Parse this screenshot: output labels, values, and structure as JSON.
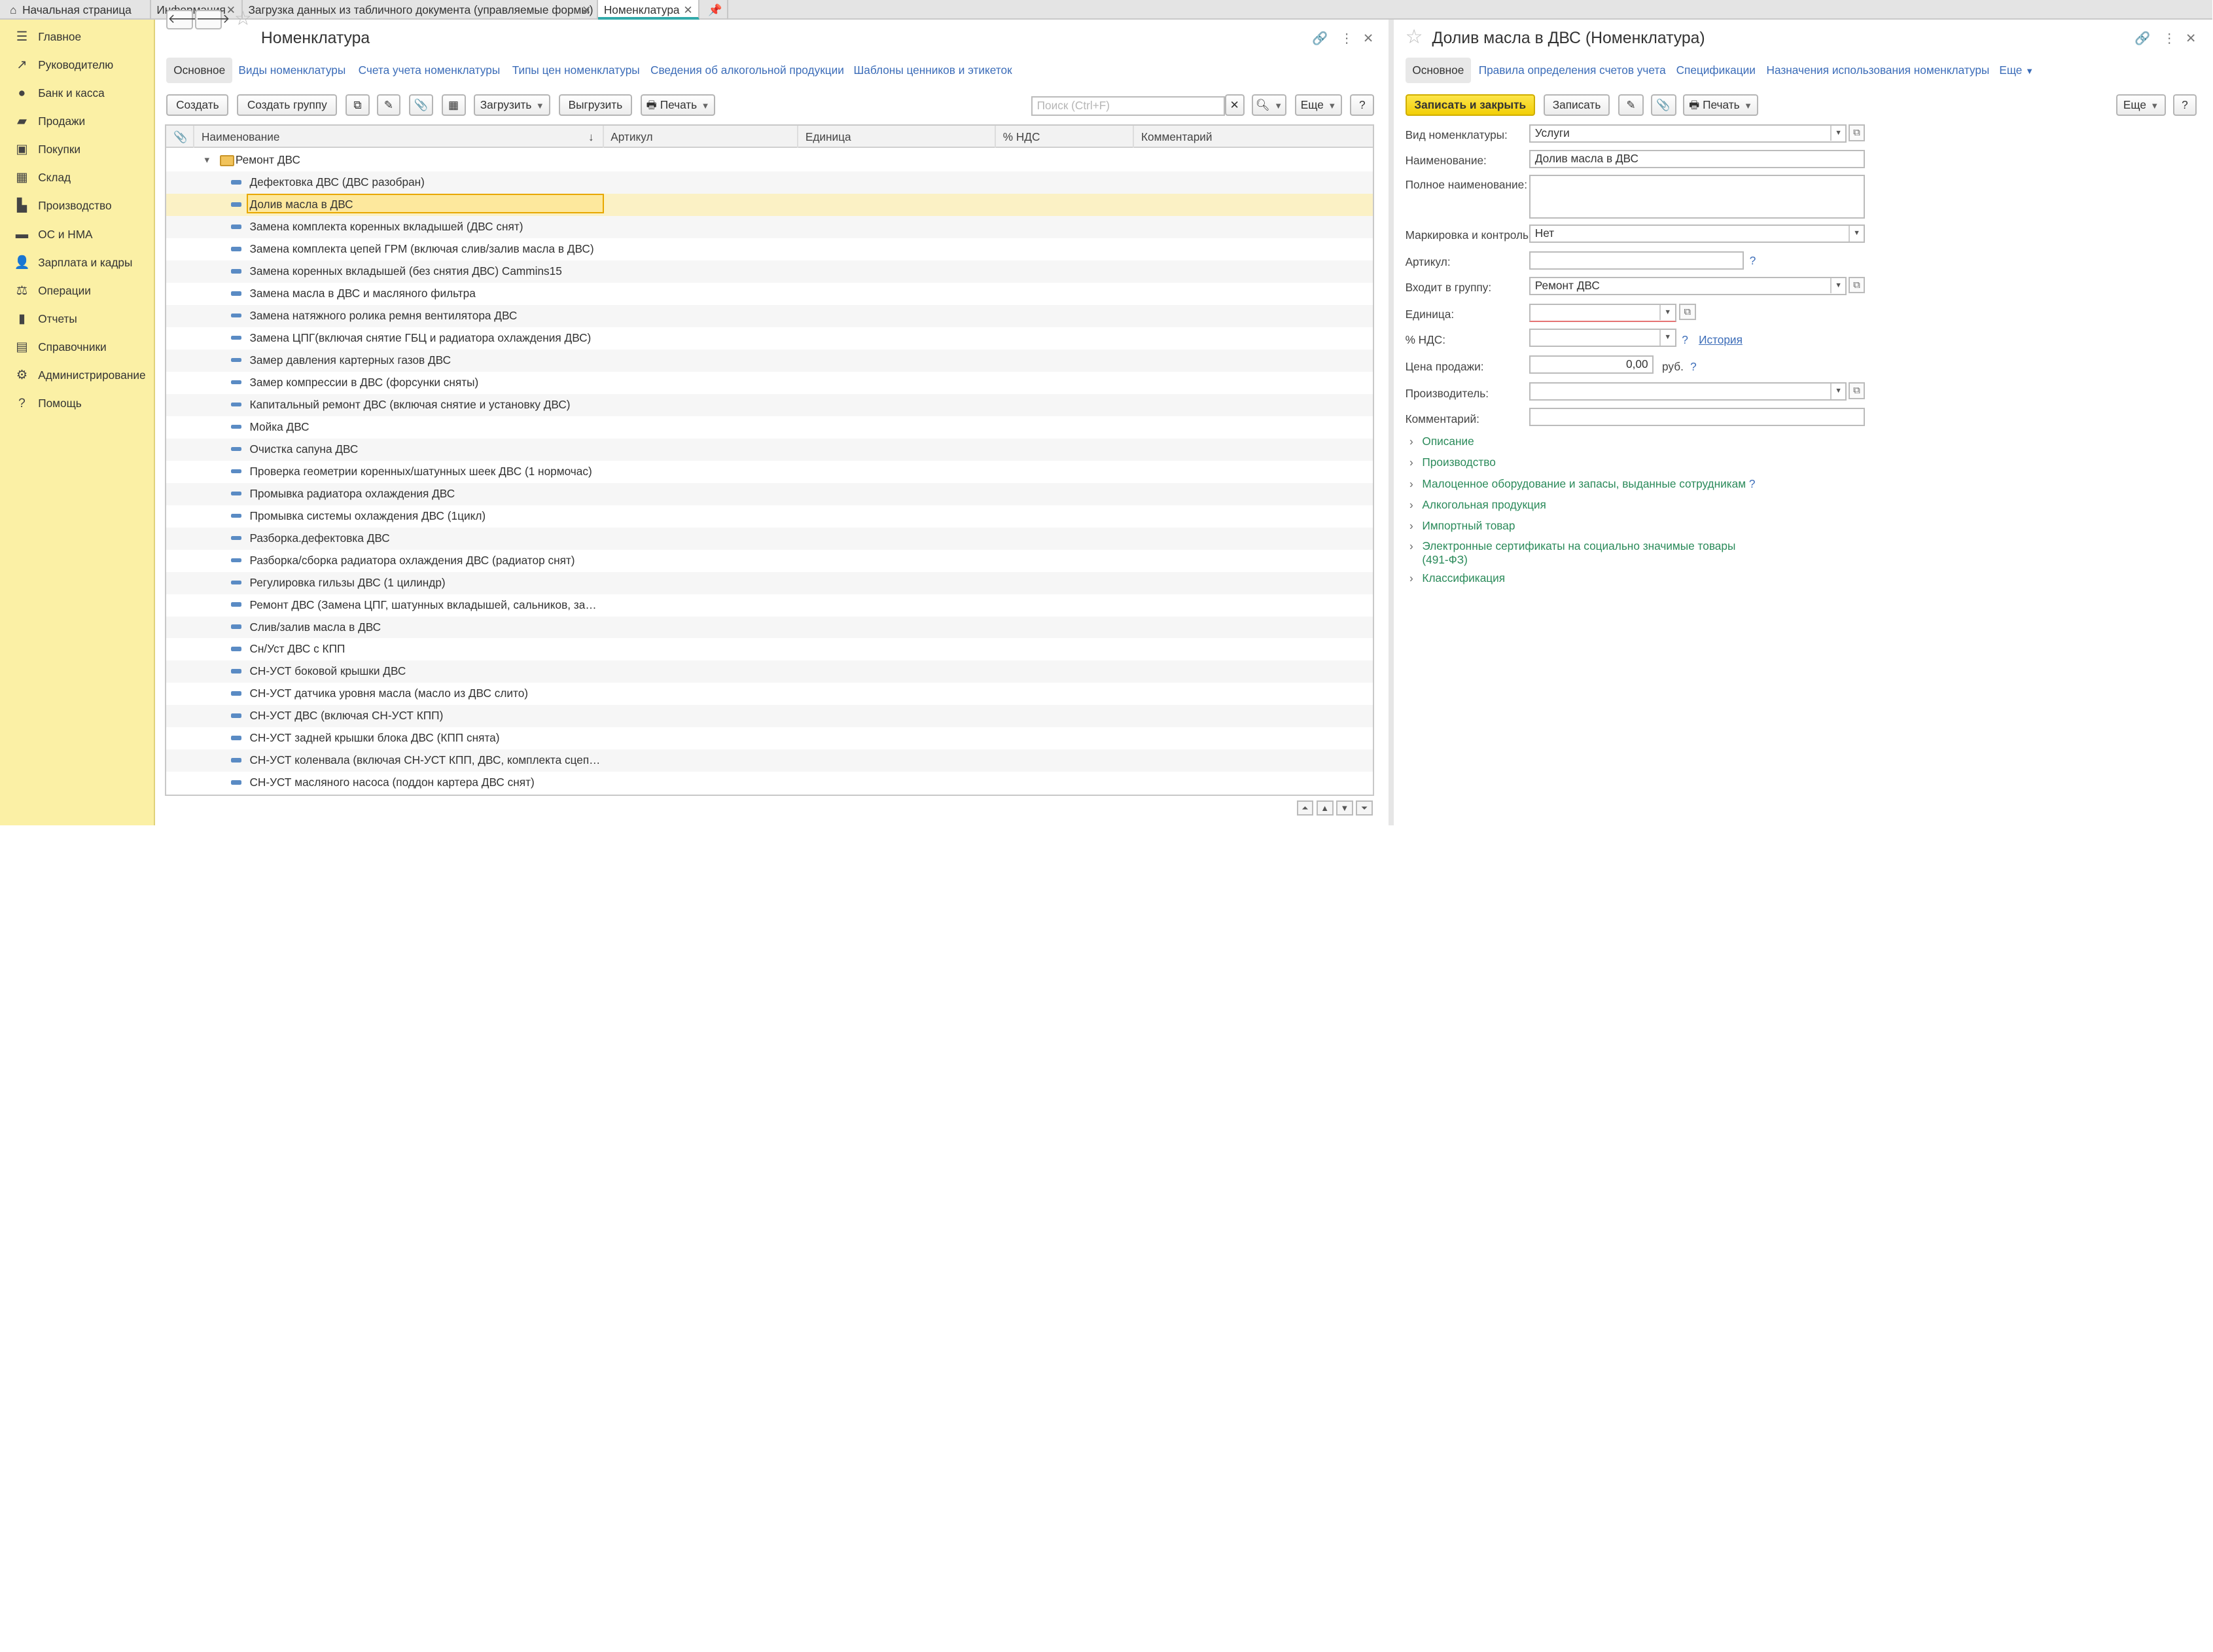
{
  "tabs": [
    {
      "label": "Начальная страница"
    },
    {
      "label": "Информация"
    },
    {
      "label": "Загрузка данных из табличного документа (управляемые формы)"
    },
    {
      "label": "Номенклатура"
    }
  ],
  "sidebar": {
    "items": [
      {
        "label": "Главное",
        "icon": "menu-icon"
      },
      {
        "label": "Руководителю",
        "icon": "trend-icon"
      },
      {
        "label": "Банк и касса",
        "icon": "coin-icon"
      },
      {
        "label": "Продажи",
        "icon": "bag-icon"
      },
      {
        "label": "Покупки",
        "icon": "cart-icon"
      },
      {
        "label": "Склад",
        "icon": "warehouse-icon"
      },
      {
        "label": "Производство",
        "icon": "factory-icon"
      },
      {
        "label": "ОС и НМА",
        "icon": "truck-icon"
      },
      {
        "label": "Зарплата и кадры",
        "icon": "person-icon"
      },
      {
        "label": "Операции",
        "icon": "operations-icon"
      },
      {
        "label": "Отчеты",
        "icon": "report-icon"
      },
      {
        "label": "Справочники",
        "icon": "book-icon"
      },
      {
        "label": "Администрирование",
        "icon": "gear-icon"
      },
      {
        "label": "Помощь",
        "icon": "help-icon"
      }
    ]
  },
  "left": {
    "title": "Номенклатура",
    "subnav": [
      "Основное",
      "Виды номенклатуры",
      "Счета учета номенклатуры",
      "Типы цен номенклатуры",
      "Сведения об алкогольной продукции",
      "Шаблоны ценников и этикеток"
    ],
    "toolbar": {
      "create": "Создать",
      "create_group": "Создать группу",
      "load": "Загрузить",
      "unload": "Выгрузить",
      "print": "Печать",
      "more": "Еще",
      "help": "?"
    },
    "search_placeholder": "Поиск (Ctrl+F)",
    "columns": [
      "Наименование",
      "Артикул",
      "Единица",
      "% НДС",
      "Комментарий"
    ],
    "group": "Ремонт ДВС",
    "rows": [
      "Дефектовка ДВС (ДВС разобран)",
      "Долив масла в ДВС",
      "Замена комплекта коренных вкладышей (ДВС снят)",
      "Замена комплекта цепей ГРМ  (включая слив/залив масла в ДВС)",
      "Замена коренных вкладышей (без снятия ДВС) Cammins15",
      "Замена масла в ДВС и масляного фильтра",
      "Замена натяжного ролика ремня вентилятора ДВС",
      "Замена ЦПГ(включая снятие ГБЦ и радиатора охлаждения ДВС)",
      "Замер давления картерных газов ДВС",
      "Замер компрессии в ДВС (форсунки сняты)",
      "Капитальный ремонт ДВС (включая снятие и установку ДВС)",
      "Мойка ДВС",
      "Очистка сапуна ДВС",
      "Проверка геометрии коренных/шатунных шеек ДВС (1 нормочас)",
      "Промывка радиатора охлаждения ДВС",
      "Промывка системы охлаждения ДВС (1цикл)",
      "Разборка.дефектовка ДВС",
      "Разборка/сборка радиатора охлаждения ДВС (радиатор снят)",
      "Регулировка гильзы ДВС (1 цилиндр)",
      "Ремонт ДВС (Замена ЦПГ, шатунных вкладышей, сальников, зам…",
      "Слив/залив масла в ДВС",
      "Сн/Уст ДВС с КПП",
      "СН-УСТ боковой крышки ДВС",
      "СН-УСТ датчика уровня масла (масло из ДВС слито)",
      "СН-УСТ ДВС (включая СН-УСТ КПП)",
      "СН-УСТ задней крышки блока ДВС (КПП снята)",
      "СН-УСТ коленвала (включая СН-УСТ КПП, ДВС, комплекта сцепл…",
      "СН-УСТ масляного насоса (поддон картера ДВС снят)"
    ]
  },
  "right": {
    "title": "Долив масла в ДВС (Номенклатура)",
    "subnav": [
      "Основное",
      "Правила определения счетов учета",
      "Спецификации",
      "Назначения использования номенклатуры",
      "Еще"
    ],
    "toolbar": {
      "save_close": "Записать и закрыть",
      "save": "Записать",
      "print": "Печать",
      "more": "Еще",
      "help": "?"
    },
    "fields": {
      "kind_label": "Вид номенклатуры:",
      "kind_value": "Услуги",
      "name_label": "Наименование:",
      "name_value": "Долив масла в ДВС",
      "fullname_label": "Полное наименование:",
      "fullname_value": "",
      "marking_label": "Маркировка и контроль:",
      "marking_value": "Нет",
      "article_label": "Артикул:",
      "article_value": "",
      "group_label": "Входит в группу:",
      "group_value": "Ремонт ДВС",
      "unit_label": "Единица:",
      "unit_value": "",
      "vat_label": "% НДС:",
      "vat_value": "",
      "history": "История",
      "price_label": "Цена продажи:",
      "price_value": "0,00",
      "currency": "руб.",
      "maker_label": "Производитель:",
      "maker_value": "",
      "comment_label": "Комментарий:",
      "comment_value": ""
    },
    "groups": [
      "Описание",
      "Производство",
      "Малоценное оборудование и запасы, выданные сотрудникам",
      "Алкогольная продукция",
      "Импортный товар",
      "Электронные сертификаты на социально значимые товары",
      "Классификация"
    ],
    "group_cert_line2": "(491-ФЗ)",
    "help_mark": "?"
  }
}
